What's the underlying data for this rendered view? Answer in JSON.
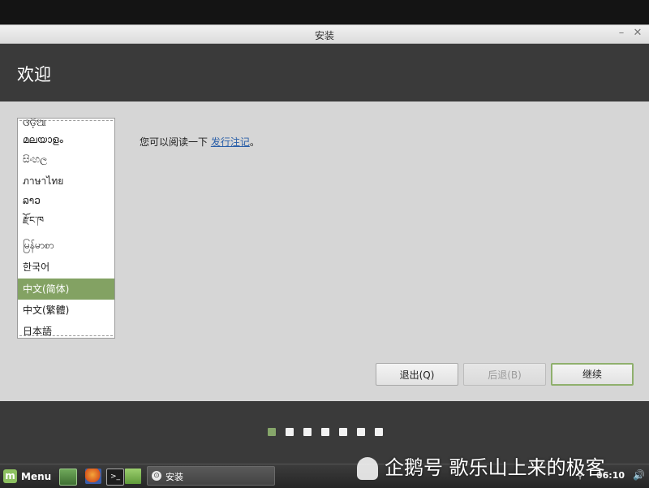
{
  "window": {
    "title": "安装",
    "minimize_glyph": "–",
    "close_glyph": "✕"
  },
  "header": {
    "title": "欢迎"
  },
  "languages": [
    {
      "label": "ଓଡ଼ିଆ",
      "selected": false
    },
    {
      "label": "മലയാളം",
      "selected": false
    },
    {
      "label": "සිංහල",
      "selected": false
    },
    {
      "label": "ภาษาไทย",
      "selected": false
    },
    {
      "label": "ລາວ",
      "selected": false
    },
    {
      "label": "རྫོང་ཁ",
      "selected": false
    },
    {
      "label": "မြန်မာစာ",
      "selected": false
    },
    {
      "label": "한국어",
      "selected": false
    },
    {
      "label": "中文(简体)",
      "selected": true
    },
    {
      "label": "中文(繁體)",
      "selected": false
    },
    {
      "label": "日本語",
      "selected": false
    }
  ],
  "release": {
    "prefix": "您可以阅读一下 ",
    "link": "发行注记",
    "suffix": "。"
  },
  "buttons": {
    "quit": "退出(Q)",
    "back": "后退(B)",
    "continue": "继续"
  },
  "progress": {
    "total_steps": 7,
    "current_step": 1
  },
  "taskbar": {
    "menu_label": "Menu",
    "task_label": "安装",
    "clock": "06:10"
  },
  "watermark": "企鹅号 歌乐山上来的极客",
  "colors": {
    "accent": "#86a66a",
    "header": "#3a3a3a",
    "link": "#2a5fa8"
  },
  "icons": [
    "mint-logo-icon",
    "desktop-icon",
    "firefox-icon",
    "terminal-icon",
    "folder-icon",
    "installer-icon",
    "network-icon",
    "volume-icon"
  ]
}
